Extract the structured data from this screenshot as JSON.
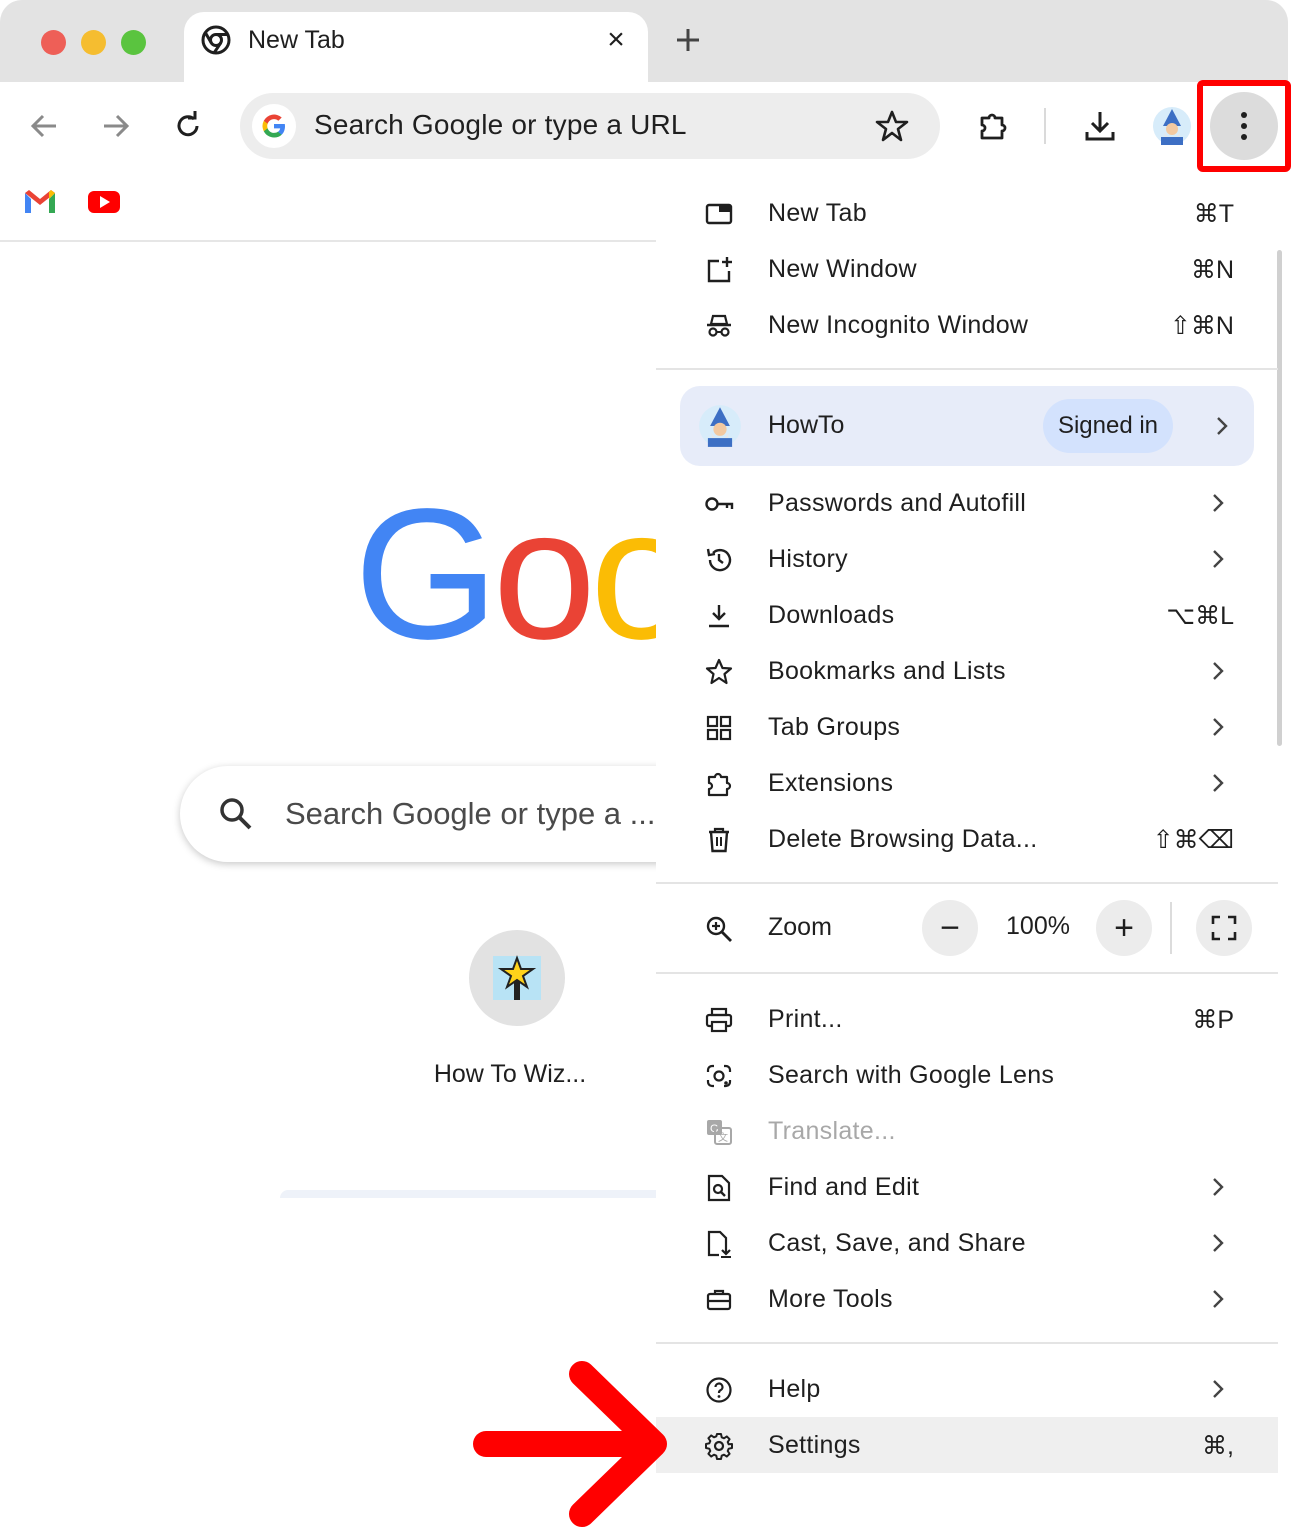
{
  "window": {
    "traffic_lights": {
      "close": "#ee5f57",
      "minimize": "#f5bd30",
      "zoom": "#5ac43f"
    }
  },
  "tab": {
    "title": "New Tab",
    "close_glyph": "×"
  },
  "toolbar": {
    "omnibox_text": "Search Google or type a URL"
  },
  "ntp": {
    "logo_letters": [
      "G",
      "o",
      "o"
    ],
    "logo_colors": [
      "#4285f4",
      "#ea4335",
      "#fbbc05"
    ],
    "search_placeholder": "Search Google or type a ...",
    "shortcut_label": "How To Wiz..."
  },
  "menu": {
    "group1": [
      {
        "label": "New Tab",
        "shortcut": "⌘T",
        "icon": "new-tab-icon"
      },
      {
        "label": "New Window",
        "shortcut": "⌘N",
        "icon": "new-window-icon"
      },
      {
        "label": "New Incognito Window",
        "shortcut": "⇧⌘N",
        "icon": "incognito-icon"
      }
    ],
    "profile": {
      "name": "HowTo",
      "badge": "Signed in"
    },
    "group2": [
      {
        "label": "Passwords and Autofill",
        "icon": "key-icon"
      },
      {
        "label": "History",
        "icon": "history-icon"
      },
      {
        "label": "Downloads",
        "shortcut": "⌥⌘L",
        "icon": "download-icon"
      },
      {
        "label": "Bookmarks and Lists",
        "icon": "star-icon"
      },
      {
        "label": "Tab Groups",
        "icon": "tab-groups-icon"
      },
      {
        "label": "Extensions",
        "icon": "puzzle-icon"
      },
      {
        "label": "Delete Browsing Data...",
        "shortcut": "⇧⌘⌫",
        "icon": "trash-icon"
      }
    ],
    "zoom": {
      "label": "Zoom",
      "value": "100%",
      "minus": "−",
      "plus": "+"
    },
    "group3": [
      {
        "label": "Print...",
        "shortcut": "⌘P",
        "icon": "print-icon"
      },
      {
        "label": "Search with Google Lens",
        "icon": "lens-icon"
      },
      {
        "label": "Translate...",
        "icon": "translate-icon",
        "disabled": true
      },
      {
        "label": "Find and Edit",
        "icon": "find-icon"
      },
      {
        "label": "Cast, Save, and Share",
        "icon": "cast-save-icon"
      },
      {
        "label": "More Tools",
        "icon": "toolbox-icon"
      }
    ],
    "group4": [
      {
        "label": "Help",
        "icon": "help-icon"
      },
      {
        "label": "Settings",
        "shortcut": "⌘,",
        "icon": "gear-icon",
        "highlighted": true
      }
    ]
  },
  "annotations": {
    "highlight_color": "#ff0000"
  }
}
